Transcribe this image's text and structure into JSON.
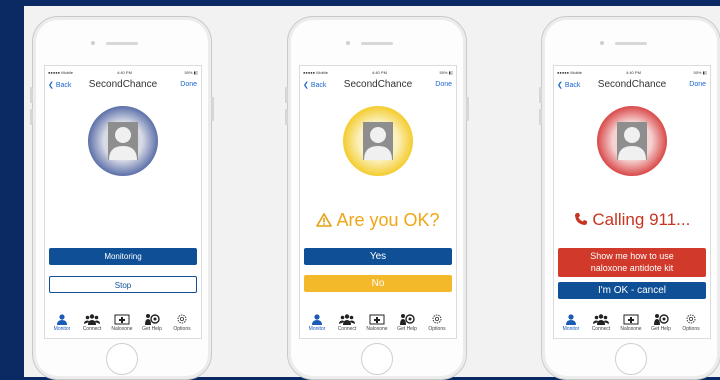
{
  "status": {
    "carrier": "●●●●● Mobile ",
    "time": "4:40 PM",
    "battery": "50% ▮▯"
  },
  "nav": {
    "back_label": "Back",
    "title": "SecondChance",
    "done_label": "Done"
  },
  "tabs": [
    "Monitor",
    "Connect",
    "Naloxone",
    "Get Help",
    "Options"
  ],
  "screens": [
    {
      "state": "monitoring",
      "ring_color": "#5b6fa8",
      "primary_button": "Monitoring",
      "secondary_button": "Stop"
    },
    {
      "state": "check",
      "ring_color": "#f4cc2e",
      "alert_icon": "warning-icon",
      "alert_text": "Are you OK?",
      "primary_button": "Yes",
      "secondary_button": "No"
    },
    {
      "state": "calling",
      "ring_color": "#d94848",
      "alert_icon": "phone-icon",
      "alert_text": "Calling 911...",
      "primary_button_line1": "Show me how to use",
      "primary_button_line2": "naloxone antidote kit",
      "secondary_button": "I'm OK - cancel"
    }
  ],
  "colors": {
    "navy": "#0e4f96",
    "yellow": "#f4b82b",
    "red": "#d1392b",
    "link": "#1b66d1"
  }
}
